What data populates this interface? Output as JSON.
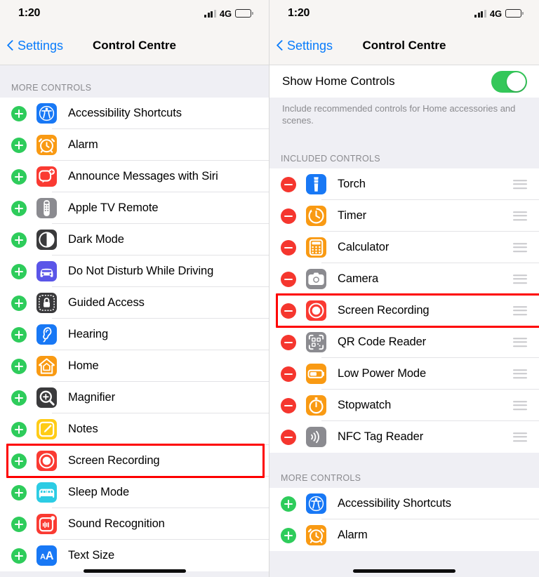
{
  "status_bar": {
    "time": "1:20",
    "network": "4G",
    "signal_icon": "cellular-signal-icon",
    "battery_icon": "battery-icon"
  },
  "nav": {
    "back_label": "Settings",
    "back_icon": "chevron-left-icon",
    "title": "Control Centre"
  },
  "colors": {
    "add_green": "#2ecc5b",
    "remove_red": "#f5362e",
    "highlight_red": "#fe0000",
    "tint_blue": "#0a7cfb",
    "switch_green": "#34c759",
    "background_grey": "#efeff4"
  },
  "left_screen": {
    "section_header": "MORE CONTROLS",
    "items": [
      {
        "label": "Accessibility Shortcuts",
        "action": "add",
        "icon": "accessibility-icon",
        "icon_bg": "#1878f5"
      },
      {
        "label": "Alarm",
        "action": "add",
        "icon": "alarm-clock-icon",
        "icon_bg": "#f99a13"
      },
      {
        "label": "Announce Messages with Siri",
        "action": "add",
        "icon": "announce-messages-icon",
        "icon_bg": "#fa3a32"
      },
      {
        "label": "Apple TV Remote",
        "action": "add",
        "icon": "apple-tv-remote-icon",
        "icon_bg": "#8b8b90"
      },
      {
        "label": "Dark Mode",
        "action": "add",
        "icon": "dark-mode-icon",
        "icon_bg": "#3a3a3c"
      },
      {
        "label": "Do Not Disturb While Driving",
        "action": "add",
        "icon": "car-icon",
        "icon_bg": "#5a55e8"
      },
      {
        "label": "Guided Access",
        "action": "add",
        "icon": "guided-access-lock-icon",
        "icon_bg": "#3a3a3c"
      },
      {
        "label": "Hearing",
        "action": "add",
        "icon": "hearing-ear-icon",
        "icon_bg": "#1878f5"
      },
      {
        "label": "Home",
        "action": "add",
        "icon": "home-house-icon",
        "icon_bg": "#f99a13"
      },
      {
        "label": "Magnifier",
        "action": "add",
        "icon": "magnifier-icon",
        "icon_bg": "#3a3a3c"
      },
      {
        "label": "Notes",
        "action": "add",
        "icon": "notes-pencil-icon",
        "icon_bg": "#ffcc17"
      },
      {
        "label": "Screen Recording",
        "action": "add",
        "icon": "screen-recording-icon",
        "icon_bg": "#fa3a32",
        "highlighted": true
      },
      {
        "label": "Sleep Mode",
        "action": "add",
        "icon": "sleep-bed-icon",
        "icon_bg": "#2ccce4"
      },
      {
        "label": "Sound Recognition",
        "action": "add",
        "icon": "sound-recognition-icon",
        "icon_bg": "#fa3a32"
      },
      {
        "label": "Text Size",
        "action": "add",
        "icon": "text-size-icon",
        "icon_bg": "#1878f5"
      }
    ]
  },
  "right_screen": {
    "home_controls": {
      "label": "Show Home Controls",
      "toggle_state": "on",
      "footnote": "Include recommended controls for Home accessories and scenes."
    },
    "included_header": "INCLUDED CONTROLS",
    "included_items": [
      {
        "label": "Torch",
        "action": "remove",
        "icon": "torch-flashlight-icon",
        "icon_bg": "#1878f5"
      },
      {
        "label": "Timer",
        "action": "remove",
        "icon": "timer-icon",
        "icon_bg": "#f99a13"
      },
      {
        "label": "Calculator",
        "action": "remove",
        "icon": "calculator-icon",
        "icon_bg": "#f99a13"
      },
      {
        "label": "Camera",
        "action": "remove",
        "icon": "camera-icon",
        "icon_bg": "#8b8b90"
      },
      {
        "label": "Screen Recording",
        "action": "remove",
        "icon": "screen-recording-icon",
        "icon_bg": "#fa3a32",
        "highlighted": true
      },
      {
        "label": "QR Code Reader",
        "action": "remove",
        "icon": "qr-code-icon",
        "icon_bg": "#8b8b90"
      },
      {
        "label": "Low Power Mode",
        "action": "remove",
        "icon": "low-power-battery-icon",
        "icon_bg": "#f99a13"
      },
      {
        "label": "Stopwatch",
        "action": "remove",
        "icon": "stopwatch-icon",
        "icon_bg": "#f99a13"
      },
      {
        "label": "NFC Tag Reader",
        "action": "remove",
        "icon": "nfc-tag-icon",
        "icon_bg": "#8b8b90"
      }
    ],
    "more_header": "MORE CONTROLS",
    "more_items": [
      {
        "label": "Accessibility Shortcuts",
        "action": "add",
        "icon": "accessibility-icon",
        "icon_bg": "#1878f5"
      },
      {
        "label": "Alarm",
        "action": "add",
        "icon": "alarm-clock-icon",
        "icon_bg": "#f99a13"
      }
    ]
  }
}
